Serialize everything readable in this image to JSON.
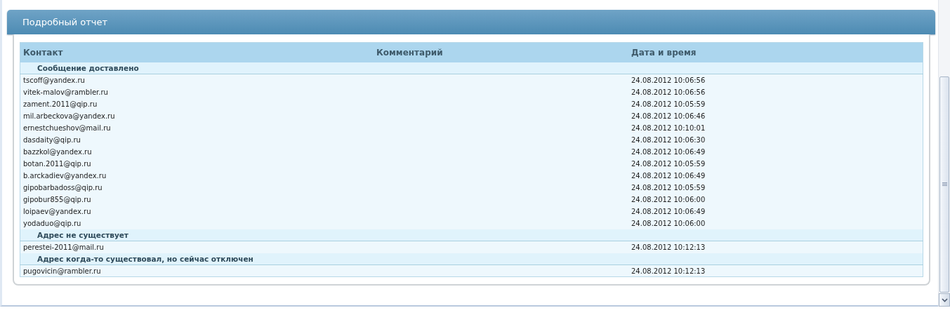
{
  "panel": {
    "title": "Подробный отчет"
  },
  "table": {
    "columns": [
      "Контакт",
      "Комментарий",
      "Дата и время"
    ],
    "groups": [
      {
        "label": "Сообщение доставлено",
        "rows": [
          {
            "contact": "tscoff@yandex.ru",
            "datetime": "24.08.2012 10:06:56"
          },
          {
            "contact": "vitek-malov@rambler.ru",
            "datetime": "24.08.2012 10:06:56"
          },
          {
            "contact": "zament.2011@qip.ru",
            "datetime": "24.08.2012 10:05:59"
          },
          {
            "contact": "mil.arbeckova@yandex.ru",
            "datetime": "24.08.2012 10:06:46"
          },
          {
            "contact": "ernestchueshov@mail.ru",
            "datetime": "24.08.2012 10:10:01"
          },
          {
            "contact": "dasdaity@qip.ru",
            "datetime": "24.08.2012 10:06:30"
          },
          {
            "contact": "bazzkol@yandex.ru",
            "datetime": "24.08.2012 10:06:49"
          },
          {
            "contact": "botan.2011@qip.ru",
            "datetime": "24.08.2012 10:05:59"
          },
          {
            "contact": "b.arckadiev@yandex.ru",
            "datetime": "24.08.2012 10:06:49"
          },
          {
            "contact": "gipobarbadoss@qip.ru",
            "datetime": "24.08.2012 10:05:59"
          },
          {
            "contact": "gipobur855@qip.ru",
            "datetime": "24.08.2012 10:06:00"
          },
          {
            "contact": "loipaev@yandex.ru",
            "datetime": "24.08.2012 10:06:49"
          },
          {
            "contact": "yodaduo@qip.ru",
            "datetime": "24.08.2012 10:06:00"
          }
        ]
      },
      {
        "label": "Адрес не существует",
        "rows": [
          {
            "contact": "perestei-2011@mail.ru",
            "datetime": "24.08.2012 10:12:13"
          }
        ]
      },
      {
        "label": "Адрес когда-то существовал, но сейчас отключен",
        "rows": [
          {
            "contact": "pugovicin@rambler.ru",
            "datetime": "24.08.2012 10:12:13"
          }
        ]
      }
    ]
  }
}
